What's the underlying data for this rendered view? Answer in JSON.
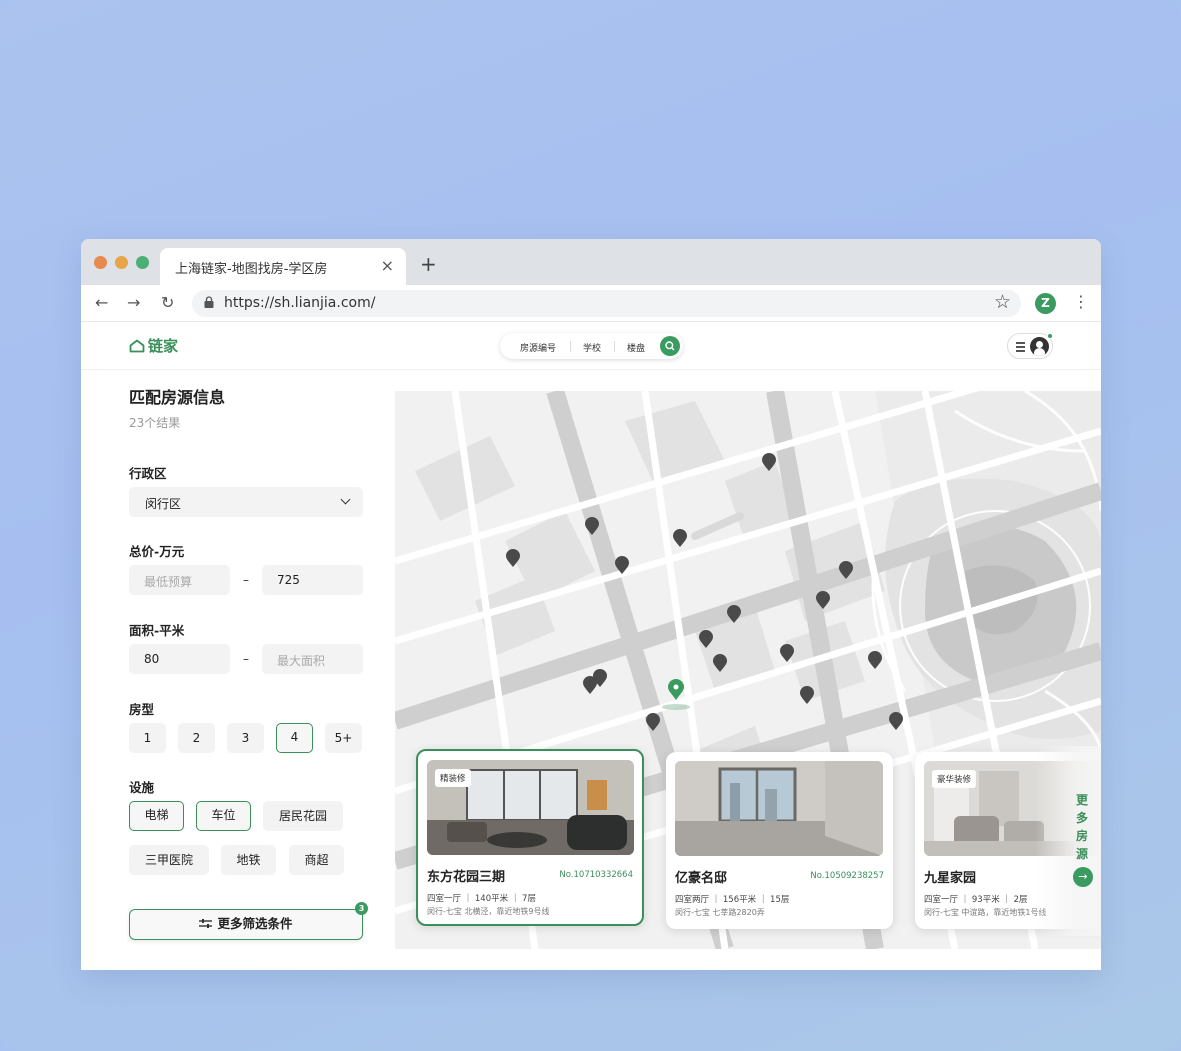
{
  "browser": {
    "tab_title": "上海链家-地图找房-学区房",
    "tab_close": "×",
    "new_tab": "+",
    "url": "https://sh.lianjia.com/",
    "profile_initial": "Z"
  },
  "header": {
    "logo_text": "链家",
    "search_items": [
      "房源编号",
      "学校",
      "楼盘"
    ]
  },
  "sidebar": {
    "title": "匹配房源信息",
    "result_count": "23个结果",
    "district": {
      "label": "行政区",
      "value": "闵行区"
    },
    "price": {
      "label": "总价-万元",
      "min_placeholder": "最低预算",
      "max_value": "725",
      "separator": "–"
    },
    "area": {
      "label": "面积-平米",
      "min_value": "80",
      "max_placeholder": "最大面积",
      "separator": "–"
    },
    "room_type": {
      "label": "房型",
      "options": [
        "1",
        "2",
        "3",
        "4",
        "5+"
      ],
      "selected": "4"
    },
    "facilities": {
      "label": "设施",
      "options": [
        "电梯",
        "车位",
        "居民花园",
        "三甲医院",
        "地铁",
        "商超"
      ],
      "selected": [
        "电梯",
        "车位"
      ]
    },
    "more_filters": {
      "label": "更多筛选条件",
      "count": "3"
    }
  },
  "listings": [
    {
      "name": "东方花园三期",
      "number": "No.10710332664",
      "tag": "精装修",
      "info": "四室一厅 ｜ 140平米 ｜ 7层",
      "address": "闵行-七宝 北横泾，靠近地铁9号线",
      "selected": true
    },
    {
      "name": "亿豪名邸",
      "number": "No.10509238257",
      "tag": "",
      "info": "四室两厅 ｜ 156平米 ｜ 15层",
      "address": "闵行-七宝 七莘路2820弄",
      "selected": false
    },
    {
      "name": "九星家园",
      "number": "",
      "tag": "豪华装修",
      "info": "四室一厅 ｜ 93平米 ｜ 2层",
      "address": "闵行-七宝 中谊路，靠近地铁1号线",
      "selected": false
    }
  ],
  "more_listings": {
    "label": "更多房源",
    "arrow": "→"
  },
  "colors": {
    "brand": "#3a8f5a",
    "pin": "#4a4a4a",
    "pin_active": "#3a9a60"
  }
}
